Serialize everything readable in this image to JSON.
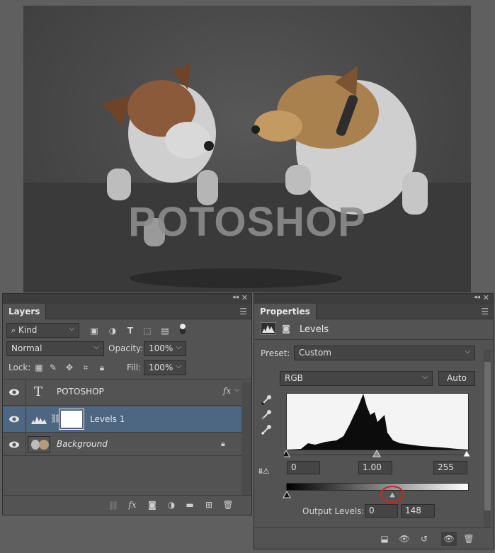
{
  "canvas": {
    "overlay_text": "POTOSHOP"
  },
  "layers_panel": {
    "tab_title": "Layers",
    "filter_kind": "Kind",
    "blend_mode": "Normal",
    "opacity_label": "Opacity:",
    "opacity_value": "100%",
    "lock_label": "Lock:",
    "fill_label": "Fill:",
    "fill_value": "100%",
    "layers": [
      {
        "name": "POTOSHOP",
        "type": "text",
        "badge": "fx"
      },
      {
        "name": "Levels 1",
        "type": "adjustment"
      },
      {
        "name": "Background",
        "type": "image"
      }
    ]
  },
  "properties_panel": {
    "tab_title": "Properties",
    "title": "Levels",
    "preset_label": "Preset:",
    "preset_value": "Custom",
    "channel": "RGB",
    "auto_button": "Auto",
    "input_black": "0",
    "input_gamma": "1.00",
    "input_white": "255",
    "output_label": "Output Levels:",
    "output_black": "0",
    "output_white": "148"
  },
  "colors": {
    "panel_bg": "#535353",
    "selected_layer": "#4d6682",
    "highlight_circle": "#d62020"
  }
}
